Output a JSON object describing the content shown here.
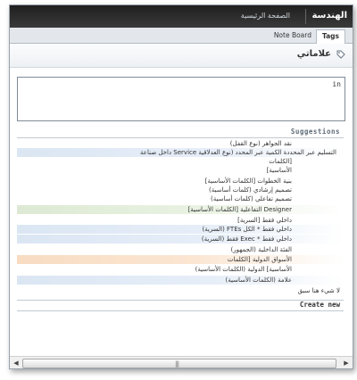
{
  "header": {
    "site_name": "الهندسة",
    "home_link": "الصفحة الرئيسية"
  },
  "tabs": [
    {
      "label": "Tags",
      "active": true
    },
    {
      "label": "Note Board",
      "active": false
    }
  ],
  "panel": {
    "title": "علاماتي",
    "title_icon": "tag-icon"
  },
  "input": {
    "value": "in"
  },
  "suggestions": {
    "header": "Suggestions",
    "items": [
      {
        "text": "نقد الجواهر (نوع القفل)"
      },
      {
        "text": "التسليم عبر المحددة الكمية عبر المحدد (نوع العدلاقية Service داخل صناعة"
      },
      {
        "text": "[الكلمات"
      },
      {
        "text": "الأساسية]"
      },
      {
        "text": "بنية الخطوات [الكلمات الأساسية]"
      },
      {
        "text": "تصميم إرشادي (كلمات أساسية)"
      },
      {
        "text": "تصميم تفاعلي (كلمات أساسية)"
      },
      {
        "text": "Designer التفاعلية [الكلمات الأساسية]"
      },
      {
        "text": "داخلي فقط [السرية]"
      },
      {
        "text": "داخلي فقط * الكل FTEs (السرية)"
      },
      {
        "text": "داخلي فقط * Exec فقط (السرية)"
      },
      {
        "text": "الفئة الداخلية (الجمهور)"
      },
      {
        "text": "الأسواق الدولية [الكلمات"
      },
      {
        "text": "الأساسية] الدولية (الكلمات الأساسية)"
      },
      {
        "text": "علامة (الكلمات الأساسية)"
      },
      {
        "text": "لا شيء هنا سبق"
      }
    ]
  },
  "create_new": "Create new",
  "scrollbar": {
    "left_arrow": "◀",
    "right_arrow": "▶",
    "grip": "|||"
  }
}
